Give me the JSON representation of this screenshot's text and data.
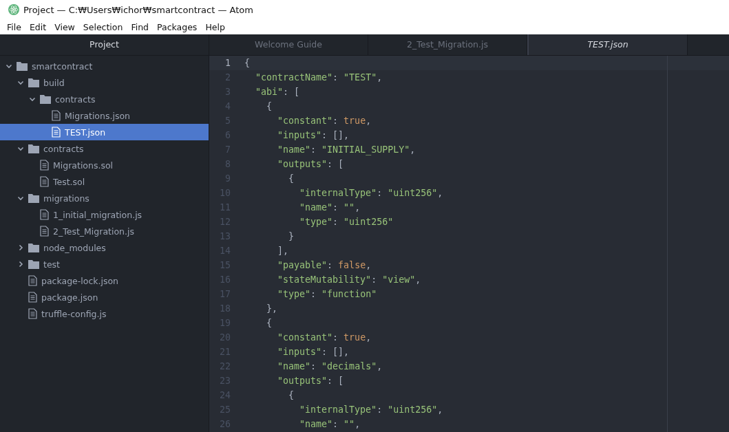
{
  "window": {
    "title": "Project — C:₩Users₩ichor₩smartcontract — Atom"
  },
  "menu": [
    "File",
    "Edit",
    "View",
    "Selection",
    "Find",
    "Packages",
    "Help"
  ],
  "sidebar": {
    "title": "Project",
    "tree": [
      {
        "label": "smartcontract",
        "kind": "folder",
        "expanded": true,
        "selected": false,
        "children": [
          {
            "label": "build",
            "kind": "folder",
            "expanded": true,
            "selected": false,
            "children": [
              {
                "label": "contracts",
                "kind": "folder",
                "expanded": true,
                "selected": false,
                "children": [
                  {
                    "label": "Migrations.json",
                    "kind": "file",
                    "selected": false
                  },
                  {
                    "label": "TEST.json",
                    "kind": "file",
                    "selected": true
                  }
                ]
              }
            ]
          },
          {
            "label": "contracts",
            "kind": "folder",
            "expanded": true,
            "selected": false,
            "children": [
              {
                "label": "Migrations.sol",
                "kind": "file",
                "selected": false
              },
              {
                "label": "Test.sol",
                "kind": "file",
                "selected": false
              }
            ]
          },
          {
            "label": "migrations",
            "kind": "folder",
            "expanded": true,
            "selected": false,
            "children": [
              {
                "label": "1_initial_migration.js",
                "kind": "file",
                "selected": false
              },
              {
                "label": "2_Test_Migration.js",
                "kind": "file",
                "selected": false
              }
            ]
          },
          {
            "label": "node_modules",
            "kind": "folder",
            "expanded": false,
            "selected": false
          },
          {
            "label": "test",
            "kind": "folder",
            "expanded": false,
            "selected": false
          },
          {
            "label": "package-lock.json",
            "kind": "file",
            "selected": false
          },
          {
            "label": "package.json",
            "kind": "file",
            "selected": false
          },
          {
            "label": "truffle-config.js",
            "kind": "file",
            "selected": false
          }
        ]
      }
    ]
  },
  "tabs": [
    {
      "label": "Welcome Guide",
      "selected": false,
      "pending": false
    },
    {
      "label": "2_Test_Migration.js",
      "selected": false,
      "pending": false
    },
    {
      "label": "TEST.json",
      "selected": true,
      "pending": true
    }
  ],
  "editor": {
    "lines": [
      {
        "number": "1",
        "current": true,
        "tokens": [
          {
            "kind": "punct",
            "text": "{"
          }
        ]
      },
      {
        "number": "2",
        "current": false,
        "tokens": [
          {
            "kind": "string",
            "text": "  \"contractName\""
          },
          {
            "kind": "punct",
            "text": ": "
          },
          {
            "kind": "string",
            "text": "\"TEST\""
          },
          {
            "kind": "punct",
            "text": ","
          }
        ]
      },
      {
        "number": "3",
        "current": false,
        "tokens": [
          {
            "kind": "string",
            "text": "  \"abi\""
          },
          {
            "kind": "punct",
            "text": ": ["
          }
        ]
      },
      {
        "number": "4",
        "current": false,
        "tokens": [
          {
            "kind": "punct",
            "text": "    {"
          }
        ]
      },
      {
        "number": "5",
        "current": false,
        "tokens": [
          {
            "kind": "string",
            "text": "      \"constant\""
          },
          {
            "kind": "punct",
            "text": ": "
          },
          {
            "kind": "literal",
            "text": "true"
          },
          {
            "kind": "punct",
            "text": ","
          }
        ]
      },
      {
        "number": "6",
        "current": false,
        "tokens": [
          {
            "kind": "string",
            "text": "      \"inputs\""
          },
          {
            "kind": "punct",
            "text": ": [],"
          }
        ]
      },
      {
        "number": "7",
        "current": false,
        "tokens": [
          {
            "kind": "string",
            "text": "      \"name\""
          },
          {
            "kind": "punct",
            "text": ": "
          },
          {
            "kind": "string",
            "text": "\"INITIAL_SUPPLY\""
          },
          {
            "kind": "punct",
            "text": ","
          }
        ]
      },
      {
        "number": "8",
        "current": false,
        "tokens": [
          {
            "kind": "string",
            "text": "      \"outputs\""
          },
          {
            "kind": "punct",
            "text": ": ["
          }
        ]
      },
      {
        "number": "9",
        "current": false,
        "tokens": [
          {
            "kind": "punct",
            "text": "        {"
          }
        ]
      },
      {
        "number": "10",
        "current": false,
        "tokens": [
          {
            "kind": "string",
            "text": "          \"internalType\""
          },
          {
            "kind": "punct",
            "text": ": "
          },
          {
            "kind": "string",
            "text": "\"uint256\""
          },
          {
            "kind": "punct",
            "text": ","
          }
        ]
      },
      {
        "number": "11",
        "current": false,
        "tokens": [
          {
            "kind": "string",
            "text": "          \"name\""
          },
          {
            "kind": "punct",
            "text": ": "
          },
          {
            "kind": "string",
            "text": "\"\""
          },
          {
            "kind": "punct",
            "text": ","
          }
        ]
      },
      {
        "number": "12",
        "current": false,
        "tokens": [
          {
            "kind": "string",
            "text": "          \"type\""
          },
          {
            "kind": "punct",
            "text": ": "
          },
          {
            "kind": "string",
            "text": "\"uint256\""
          }
        ]
      },
      {
        "number": "13",
        "current": false,
        "tokens": [
          {
            "kind": "punct",
            "text": "        }"
          }
        ]
      },
      {
        "number": "14",
        "current": false,
        "tokens": [
          {
            "kind": "punct",
            "text": "      ],"
          }
        ]
      },
      {
        "number": "15",
        "current": false,
        "tokens": [
          {
            "kind": "string",
            "text": "      \"payable\""
          },
          {
            "kind": "punct",
            "text": ": "
          },
          {
            "kind": "literal",
            "text": "false"
          },
          {
            "kind": "punct",
            "text": ","
          }
        ]
      },
      {
        "number": "16",
        "current": false,
        "tokens": [
          {
            "kind": "string",
            "text": "      \"stateMutability\""
          },
          {
            "kind": "punct",
            "text": ": "
          },
          {
            "kind": "string",
            "text": "\"view\""
          },
          {
            "kind": "punct",
            "text": ","
          }
        ]
      },
      {
        "number": "17",
        "current": false,
        "tokens": [
          {
            "kind": "string",
            "text": "      \"type\""
          },
          {
            "kind": "punct",
            "text": ": "
          },
          {
            "kind": "string",
            "text": "\"function\""
          }
        ]
      },
      {
        "number": "18",
        "current": false,
        "tokens": [
          {
            "kind": "punct",
            "text": "    },"
          }
        ]
      },
      {
        "number": "19",
        "current": false,
        "tokens": [
          {
            "kind": "punct",
            "text": "    {"
          }
        ]
      },
      {
        "number": "20",
        "current": false,
        "tokens": [
          {
            "kind": "string",
            "text": "      \"constant\""
          },
          {
            "kind": "punct",
            "text": ": "
          },
          {
            "kind": "literal",
            "text": "true"
          },
          {
            "kind": "punct",
            "text": ","
          }
        ]
      },
      {
        "number": "21",
        "current": false,
        "tokens": [
          {
            "kind": "string",
            "text": "      \"inputs\""
          },
          {
            "kind": "punct",
            "text": ": [],"
          }
        ]
      },
      {
        "number": "22",
        "current": false,
        "tokens": [
          {
            "kind": "string",
            "text": "      \"name\""
          },
          {
            "kind": "punct",
            "text": ": "
          },
          {
            "kind": "string",
            "text": "\"decimals\""
          },
          {
            "kind": "punct",
            "text": ","
          }
        ]
      },
      {
        "number": "23",
        "current": false,
        "tokens": [
          {
            "kind": "string",
            "text": "      \"outputs\""
          },
          {
            "kind": "punct",
            "text": ": ["
          }
        ]
      },
      {
        "number": "24",
        "current": false,
        "tokens": [
          {
            "kind": "punct",
            "text": "        {"
          }
        ]
      },
      {
        "number": "25",
        "current": false,
        "tokens": [
          {
            "kind": "string",
            "text": "          \"internalType\""
          },
          {
            "kind": "punct",
            "text": ": "
          },
          {
            "kind": "string",
            "text": "\"uint256\""
          },
          {
            "kind": "punct",
            "text": ","
          }
        ]
      },
      {
        "number": "26",
        "current": false,
        "tokens": [
          {
            "kind": "string",
            "text": "          \"name\""
          },
          {
            "kind": "punct",
            "text": ": "
          },
          {
            "kind": "string",
            "text": "\"\""
          },
          {
            "kind": "punct",
            "text": ","
          }
        ]
      }
    ]
  }
}
